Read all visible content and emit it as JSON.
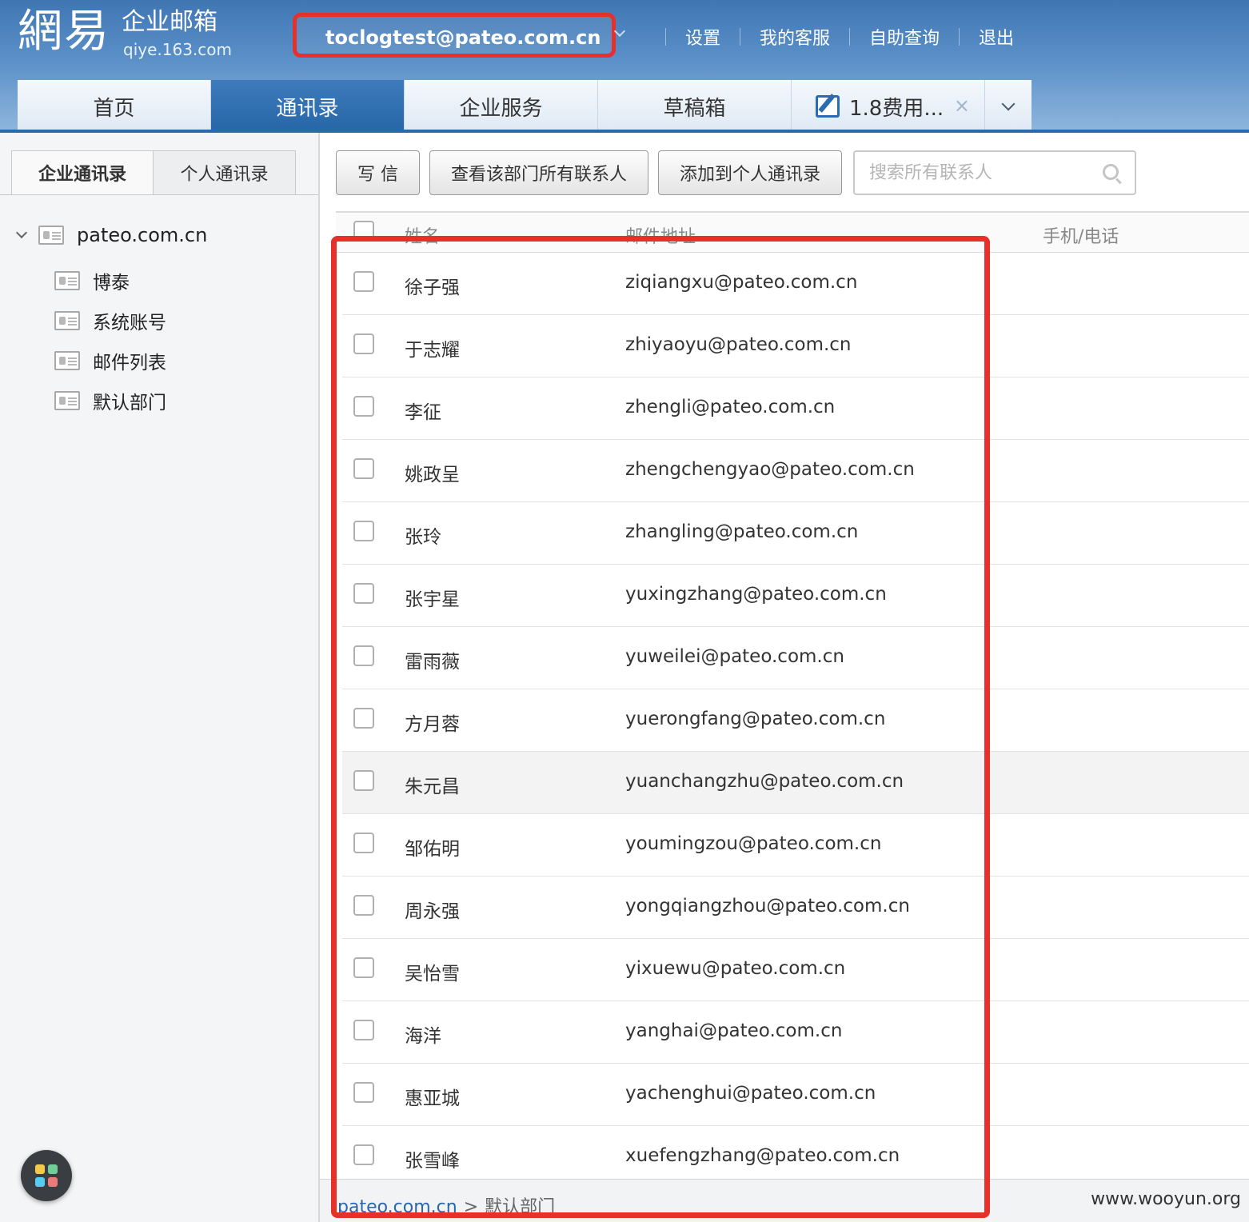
{
  "brand": {
    "logo_main": "網易",
    "logo_title": "企业邮箱",
    "logo_sub": "qiye.163.com"
  },
  "account": "toclogtest@pateo.com.cn",
  "top_links": [
    "设置",
    "我的客服",
    "自助查询",
    "退出"
  ],
  "tabs": [
    {
      "label": "首页",
      "active": false
    },
    {
      "label": "通讯录",
      "active": true
    },
    {
      "label": "企业服务",
      "active": false
    },
    {
      "label": "草稿箱",
      "active": false
    },
    {
      "label": "1.8费用...",
      "active": false
    }
  ],
  "tab_close_glyph": "×",
  "sidebar": {
    "tabs": [
      "企业通讯录",
      "个人通讯录"
    ],
    "root": "pateo.com.cn",
    "children": [
      "博泰",
      "系统账号",
      "邮件列表",
      "默认部门"
    ]
  },
  "toolbar": {
    "write_label": "写 信",
    "view_all_label": "查看该部门所有联系人",
    "add_personal_label": "添加到个人通讯录",
    "search_placeholder": "搜索所有联系人"
  },
  "table": {
    "headers": {
      "name": "姓名",
      "email": "邮件地址",
      "phone": "手机/电话"
    },
    "rows": [
      {
        "name": "徐子强",
        "email": "ziqiangxu@pateo.com.cn"
      },
      {
        "name": "于志耀",
        "email": "zhiyaoyu@pateo.com.cn"
      },
      {
        "name": "李征",
        "email": "zhengli@pateo.com.cn"
      },
      {
        "name": "姚政呈",
        "email": "zhengchengyao@pateo.com.cn"
      },
      {
        "name": "张玲",
        "email": "zhangling@pateo.com.cn"
      },
      {
        "name": "张宇星",
        "email": "yuxingzhang@pateo.com.cn"
      },
      {
        "name": "雷雨薇",
        "email": "yuweilei@pateo.com.cn"
      },
      {
        "name": "方月蓉",
        "email": "yuerongfang@pateo.com.cn"
      },
      {
        "name": "朱元昌",
        "email": "yuanchangzhu@pateo.com.cn"
      },
      {
        "name": "邹佑明",
        "email": "youmingzou@pateo.com.cn"
      },
      {
        "name": "周永强",
        "email": "yongqiangzhou@pateo.com.cn"
      },
      {
        "name": "吴怡雪",
        "email": "yixuewu@pateo.com.cn"
      },
      {
        "name": "海洋",
        "email": "yanghai@pateo.com.cn"
      },
      {
        "name": "惠亚城",
        "email": "yachenghui@pateo.com.cn"
      },
      {
        "name": "张雪峰",
        "email": "xuefengzhang@pateo.com.cn"
      }
    ]
  },
  "breadcrumb": {
    "root": "pateo.com.cn",
    "separator": ">",
    "current": "默认部门"
  },
  "watermark": "www.wooyun.org",
  "colors": {
    "header_blue": "#3f76b3",
    "active_tab": "#2665a6",
    "annotation_red": "#e8302b"
  }
}
